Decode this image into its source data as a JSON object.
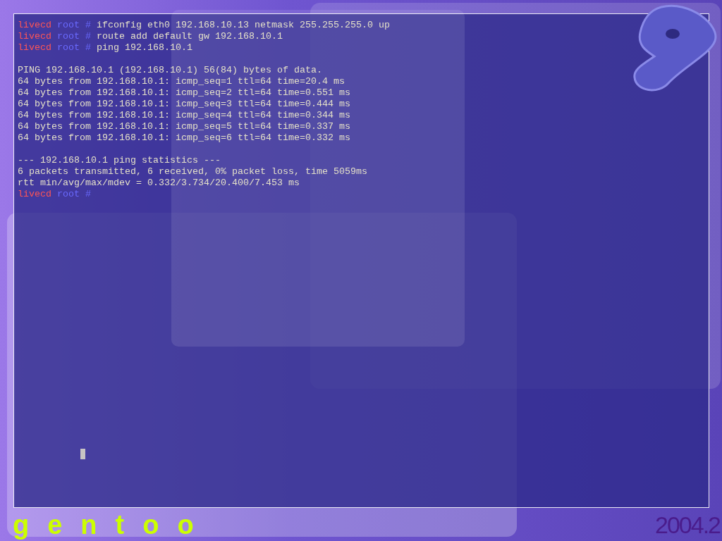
{
  "terminal": {
    "lines": [
      {
        "kind": "prompt",
        "host": "livecd",
        "user": "root",
        "symbol": "#",
        "command": "ifconfig eth0 192.168.10.13 netmask 255.255.255.0 up"
      },
      {
        "kind": "prompt",
        "host": "livecd",
        "user": "root",
        "symbol": "#",
        "command": "route add default gw 192.168.10.1"
      },
      {
        "kind": "prompt",
        "host": "livecd",
        "user": "root",
        "symbol": "#",
        "command": "ping 192.168.10.1"
      },
      {
        "kind": "blank"
      },
      {
        "kind": "output",
        "text": "PING 192.168.10.1 (192.168.10.1) 56(84) bytes of data."
      },
      {
        "kind": "output",
        "text": "64 bytes from 192.168.10.1: icmp_seq=1 ttl=64 time=20.4 ms"
      },
      {
        "kind": "output",
        "text": "64 bytes from 192.168.10.1: icmp_seq=2 ttl=64 time=0.551 ms"
      },
      {
        "kind": "output",
        "text": "64 bytes from 192.168.10.1: icmp_seq=3 ttl=64 time=0.444 ms"
      },
      {
        "kind": "output",
        "text": "64 bytes from 192.168.10.1: icmp_seq=4 ttl=64 time=0.344 ms"
      },
      {
        "kind": "output",
        "text": "64 bytes from 192.168.10.1: icmp_seq=5 ttl=64 time=0.337 ms"
      },
      {
        "kind": "output",
        "text": "64 bytes from 192.168.10.1: icmp_seq=6 ttl=64 time=0.332 ms"
      },
      {
        "kind": "blank"
      },
      {
        "kind": "output",
        "text": "--- 192.168.10.1 ping statistics ---"
      },
      {
        "kind": "output",
        "text": "6 packets transmitted, 6 received, 0% packet loss, time 5059ms"
      },
      {
        "kind": "output",
        "text": "rtt min/avg/max/mdev = 0.332/3.734/20.400/7.453 ms"
      },
      {
        "kind": "prompt",
        "host": "livecd",
        "user": "root",
        "symbol": "#"
      }
    ]
  },
  "footer": {
    "logo_text": "gentoo",
    "version": "2004.2"
  }
}
